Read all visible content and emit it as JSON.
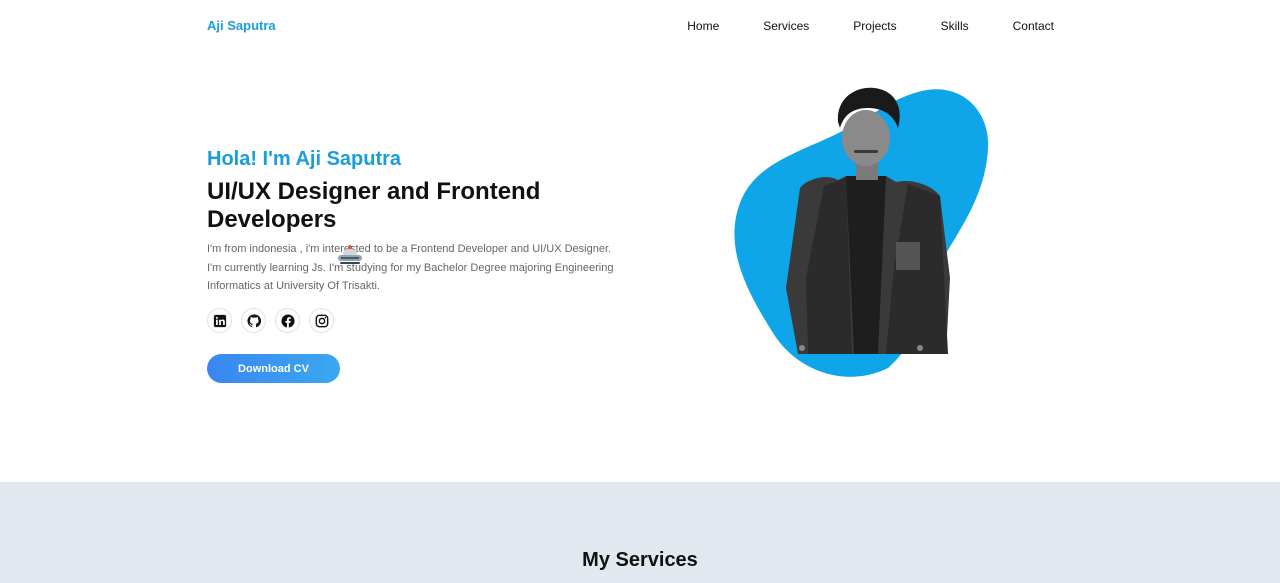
{
  "nav": {
    "brand": "Aji Saputra",
    "links": [
      "Home",
      "Services",
      "Projects",
      "Skills",
      "Contact"
    ]
  },
  "hero": {
    "greeting": "Hola! I'm Aji Saputra",
    "role": "UI/UX Designer and Frontend Developers",
    "bio": "I'm from indonesia , i'm interested to be a Frontend Developer and UI/UX Designer. I'm currently learning Js. I'm studying for my Bachelor Degree majoring Engineering Informatics at University Of Trisakti.",
    "socials": [
      "linkedin-icon",
      "github-icon",
      "facebook-icon",
      "instagram-icon"
    ],
    "cta": "Download CV"
  },
  "services": {
    "title": "My Services"
  },
  "colors": {
    "accent": "#1a9ddb",
    "blob": "#0ea5e9",
    "services_bg": "#e1e8f0"
  }
}
